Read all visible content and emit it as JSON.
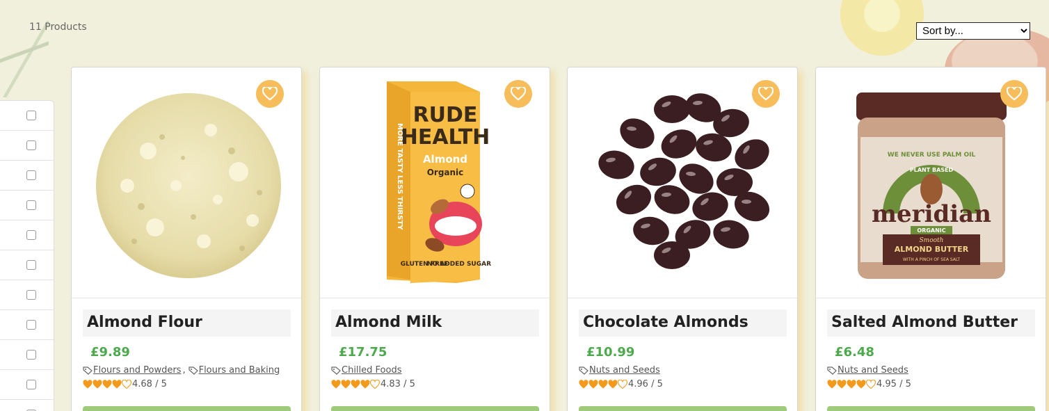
{
  "header": {
    "product_count": "11 Products",
    "sort_label": "Sort by..."
  },
  "colors": {
    "price": "#4caa4c",
    "favorite": "#f6bd5a",
    "rating": "#f39a1c",
    "add_button": "#9fca7a"
  },
  "filters": {
    "rows": 11
  },
  "products": [
    {
      "name": "Almond Flour",
      "price": "£9.89",
      "categories": [
        "Flours and Powders",
        "Flours and Baking"
      ],
      "rating_value": 4.68,
      "rating_text": "4.68 / 5",
      "image_icon": "almond-flour-image"
    },
    {
      "name": "Almond Milk",
      "price": "£17.75",
      "categories": [
        "Chilled Foods"
      ],
      "rating_value": 4.83,
      "rating_text": "4.83 / 5",
      "image_icon": "almond-milk-carton-image",
      "carton": {
        "brand_line1": "RUDE",
        "brand_line2": "HEALTH",
        "flavor": "Almond",
        "variant": "Organic",
        "side": "MORE TASTY LESS THIRSTY",
        "badge1": "GLUTEN FREE",
        "badge2": "NO ADDED SUGAR"
      }
    },
    {
      "name": "Chocolate Almonds",
      "price": "£10.99",
      "categories": [
        "Nuts and Seeds"
      ],
      "rating_value": 4.96,
      "rating_text": "4.96 / 5",
      "image_icon": "chocolate-almonds-image"
    },
    {
      "name": "Salted Almond Butter",
      "price": "£6.48",
      "categories": [
        "Nuts and Seeds"
      ],
      "rating_value": 4.95,
      "rating_text": "4.95 / 5",
      "image_icon": "almond-butter-jar-image",
      "jar": {
        "arc": "WE NEVER USE PALM OIL",
        "sub": "PLANT BASED",
        "brand": "meridian",
        "organic": "ORGANIC",
        "smooth": "Smooth",
        "product": "ALMOND BUTTER",
        "tag": "WITH A PINCH OF SEA SALT"
      }
    }
  ]
}
